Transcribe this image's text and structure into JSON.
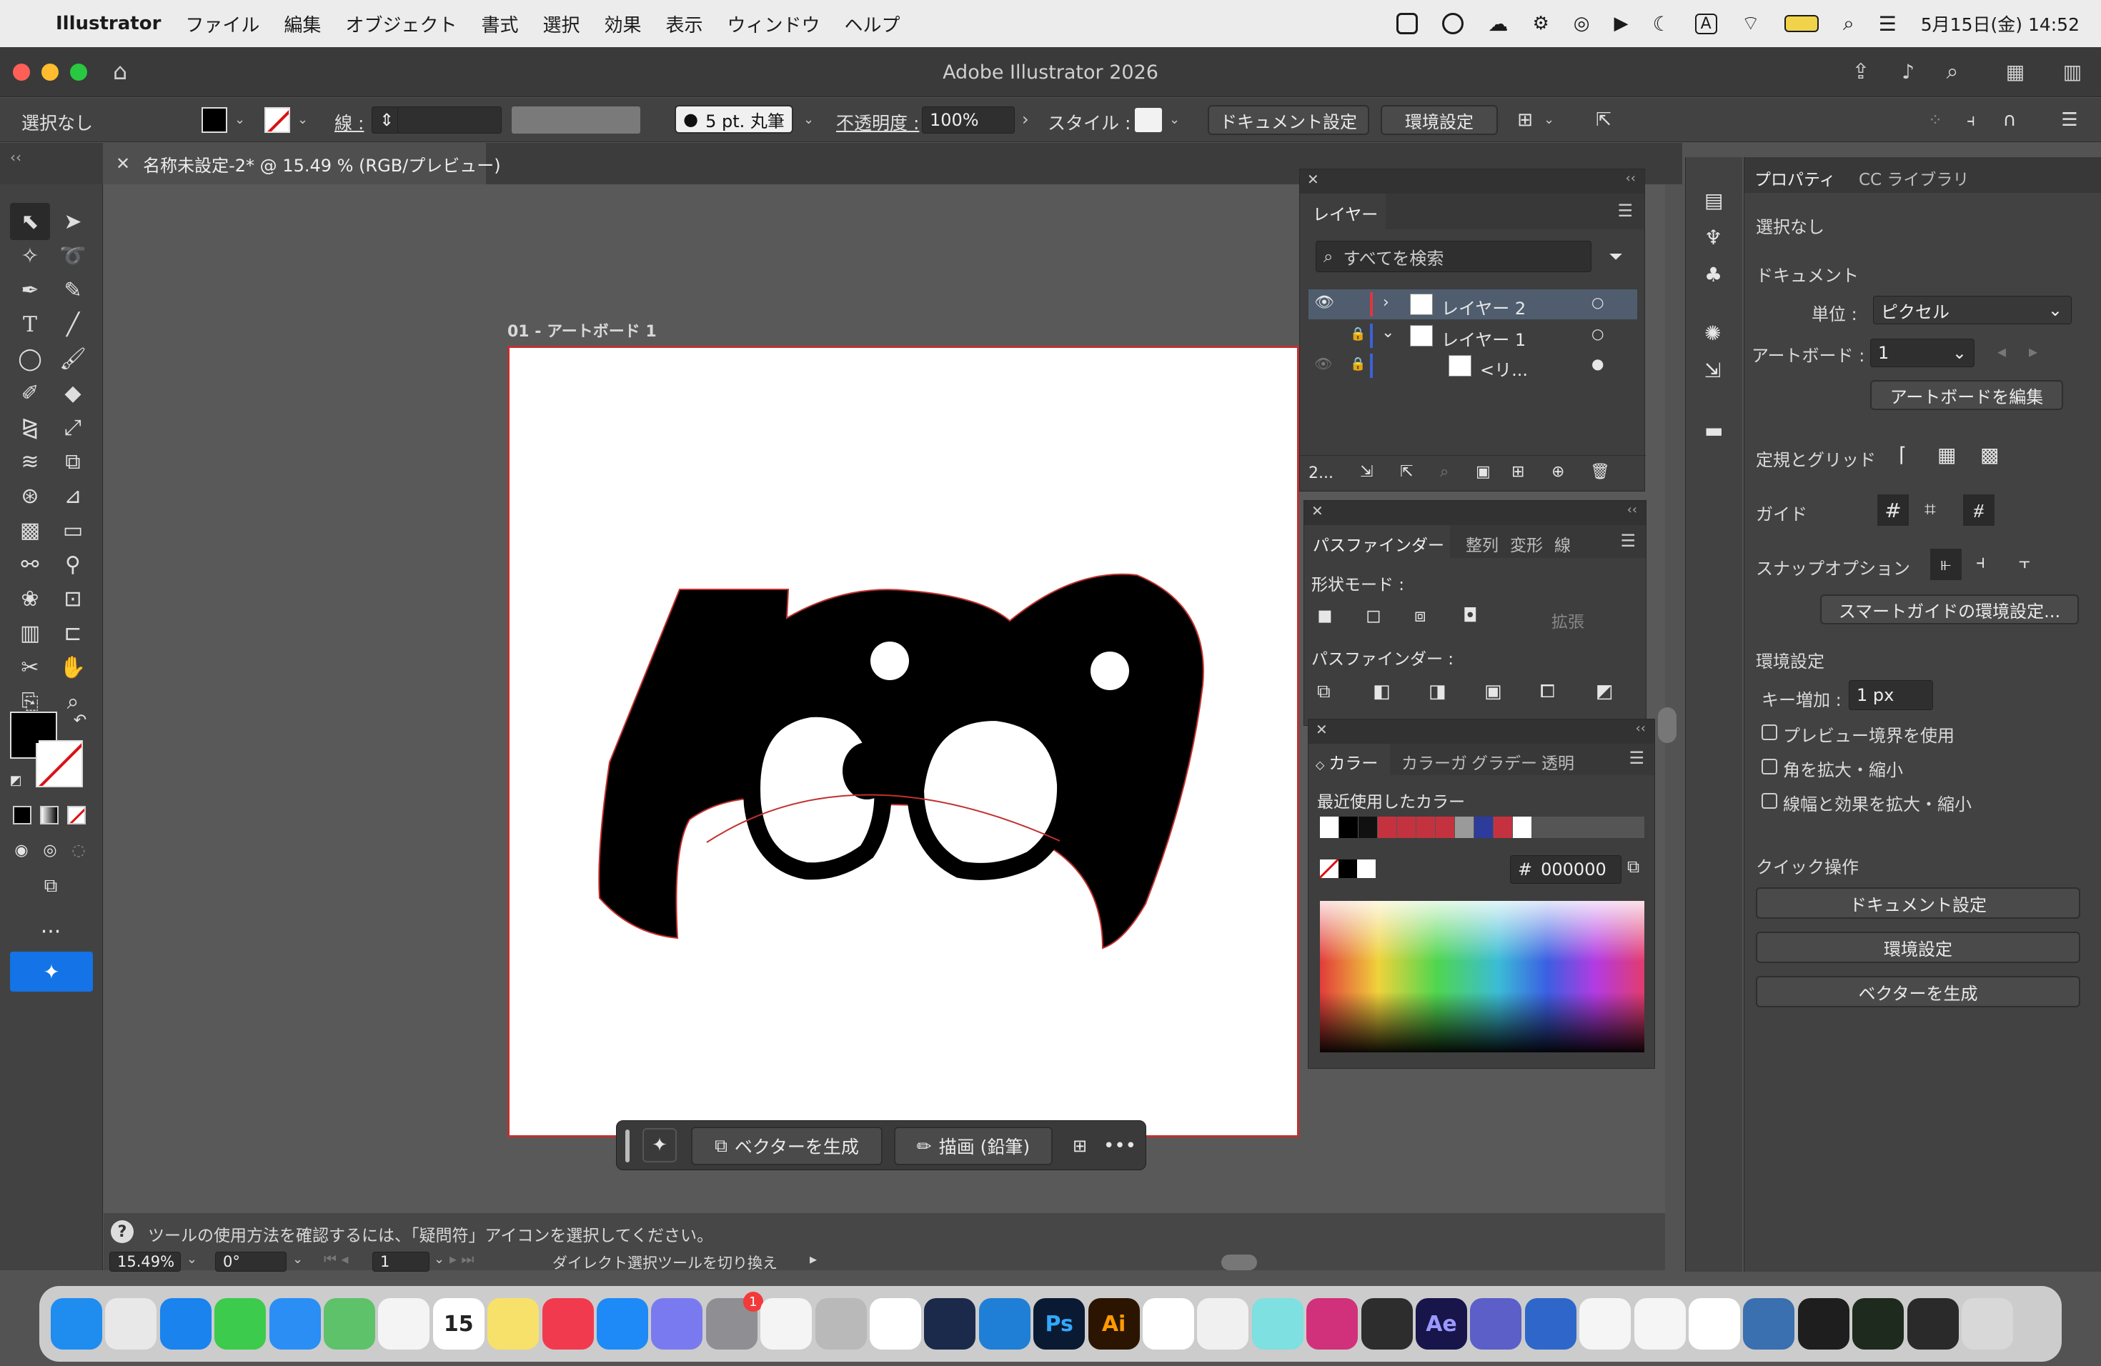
{
  "menubar": {
    "app": "Illustrator",
    "items": [
      "ファイル",
      "編集",
      "オブジェクト",
      "書式",
      "選択",
      "効果",
      "表示",
      "ウィンドウ",
      "ヘルプ"
    ],
    "input_mode": "A",
    "datetime": "5月15日(金) 14:52"
  },
  "window": {
    "title": "Adobe Illustrator 2026"
  },
  "control": {
    "selection": "選択なし",
    "stroke_label": "線 :",
    "brush": "5 pt. 丸筆",
    "opacity_label": "不透明度 :",
    "opacity_value": "100%",
    "style_label": "スタイル :",
    "doc_settings": "ドキュメント設定",
    "env_settings": "環境設定"
  },
  "document": {
    "tab_title": "名称未設定-2* @ 15.49 % (RGB/プレビュー)",
    "artboard_label": "01 - アートボード 1"
  },
  "layers": {
    "title": "レイヤー",
    "search_placeholder": "すべてを検索",
    "rows": [
      {
        "name": "レイヤー 2"
      },
      {
        "name": "レイヤー 1"
      },
      {
        "name": "<リ..."
      }
    ],
    "count": "2..."
  },
  "pathfinder": {
    "tabs": [
      "パスファインダー",
      "整列",
      "変形",
      "線"
    ],
    "shape_modes": "形状モード :",
    "expand": "拡張",
    "pathfinders": "パスファインダー :"
  },
  "color": {
    "tabs": [
      "カラー",
      "カラーガ",
      "グラデー",
      "透明"
    ],
    "recent": "最近使用したカラー",
    "hex": "000000",
    "hash": "#",
    "swatches": [
      "#ffffff",
      "#000000",
      "#111111",
      "#c4323f",
      "#c4323f",
      "#c4323f",
      "#c4323f",
      "#9a9a9a",
      "#2d3b9a",
      "#c4323f",
      "#ffffff"
    ]
  },
  "properties": {
    "tabs": [
      "プロパティ",
      "CC ライブラリ"
    ],
    "selection": "選択なし",
    "document": "ドキュメント",
    "unit_label": "単位 :",
    "unit_value": "ピクセル",
    "artboard_label": "アートボード :",
    "artboard_value": "1",
    "edit_artboard": "アートボードを編集",
    "rulers_grids": "定規とグリッド",
    "guides": "ガイド",
    "snap_options": "スナップオプション",
    "smart_guides": "スマートガイドの環境設定...",
    "prefs": "環境設定",
    "key_inc_label": "キー増加 :",
    "key_inc_value": "1 px",
    "chk_preview": "プレビュー境界を使用",
    "chk_corners": "角を拡大・縮小",
    "chk_strokes": "線幅と効果を拡大・縮小",
    "quick_actions": "クイック操作",
    "qa_doc": "ドキュメント設定",
    "qa_env": "環境設定",
    "qa_vector": "ベクターを生成"
  },
  "context_bar": {
    "generate": "ベクターを生成",
    "draw": "描画 (鉛筆)"
  },
  "status": {
    "hint": "ツールの使用方法を確認するには、「疑問符」アイコンを選択してください。",
    "zoom": "15.49%",
    "rotation": "0°",
    "artboard": "1",
    "tool": "ダイレクト選択ツールを切り換え"
  },
  "dock": {
    "apps": [
      {
        "name": "Finder",
        "color": "#1f8cf0"
      },
      {
        "name": "Launchpad",
        "color": "#e8e8e8"
      },
      {
        "name": "Safari",
        "color": "#1a83ee"
      },
      {
        "name": "Messages",
        "color": "#3ccb4c"
      },
      {
        "name": "Mail",
        "color": "#2a8ef5"
      },
      {
        "name": "Maps",
        "color": "#5ec26a"
      },
      {
        "name": "Photos",
        "color": "#f4f4f4"
      },
      {
        "name": "Calendar",
        "color": "#ffffff"
      },
      {
        "name": "Notes",
        "color": "#f7e16a"
      },
      {
        "name": "Music",
        "color": "#f23a4f"
      },
      {
        "name": "App Store",
        "color": "#1d8af7"
      },
      {
        "name": "Simulator",
        "color": "#7a7af0"
      },
      {
        "name": "System Settings",
        "color": "#8e8e93"
      },
      {
        "name": "YouTube",
        "color": "#f4f4f4"
      },
      {
        "name": "Hotkey",
        "color": "#b9b9b9"
      },
      {
        "name": "Tasks",
        "color": "#ffffff"
      },
      {
        "name": "Steam",
        "color": "#1b2a4a"
      },
      {
        "name": "VS Code",
        "color": "#1f7fd6"
      },
      {
        "name": "Photoshop",
        "color": "#0b1a33"
      },
      {
        "name": "Illustrator",
        "color": "#2b1500"
      },
      {
        "name": "Chrome",
        "color": "#ffffff"
      },
      {
        "name": "Pencil",
        "color": "#f0f0f0"
      },
      {
        "name": "Draw",
        "color": "#7ee0e0"
      },
      {
        "name": "Instagram",
        "color": "#d1317a"
      },
      {
        "name": "Blender",
        "color": "#2d2d2d"
      },
      {
        "name": "After Effects",
        "color": "#17154a"
      },
      {
        "name": "Teams",
        "color": "#5b5fc7"
      },
      {
        "name": "Mail Client",
        "color": "#2e67c9"
      },
      {
        "name": "Gemini",
        "color": "#f5f5f5"
      },
      {
        "name": "Home",
        "color": "#f5f5f5"
      },
      {
        "name": "OpenSquare",
        "color": "#ffffff"
      },
      {
        "name": "Agent",
        "color": "#3a6fb0"
      },
      {
        "name": "Terminal",
        "color": "#1e1e1e"
      },
      {
        "name": "Exec",
        "color": "#1e2a1e"
      },
      {
        "name": "Screen",
        "color": "#2a2a2a"
      },
      {
        "name": "Trash",
        "color": "#d8d8d8"
      }
    ],
    "badge": "1",
    "calendar_day": "15",
    "ps": "Ps",
    "ai": "Ai",
    "ae": "Ae"
  },
  "accent": "#1473e6"
}
